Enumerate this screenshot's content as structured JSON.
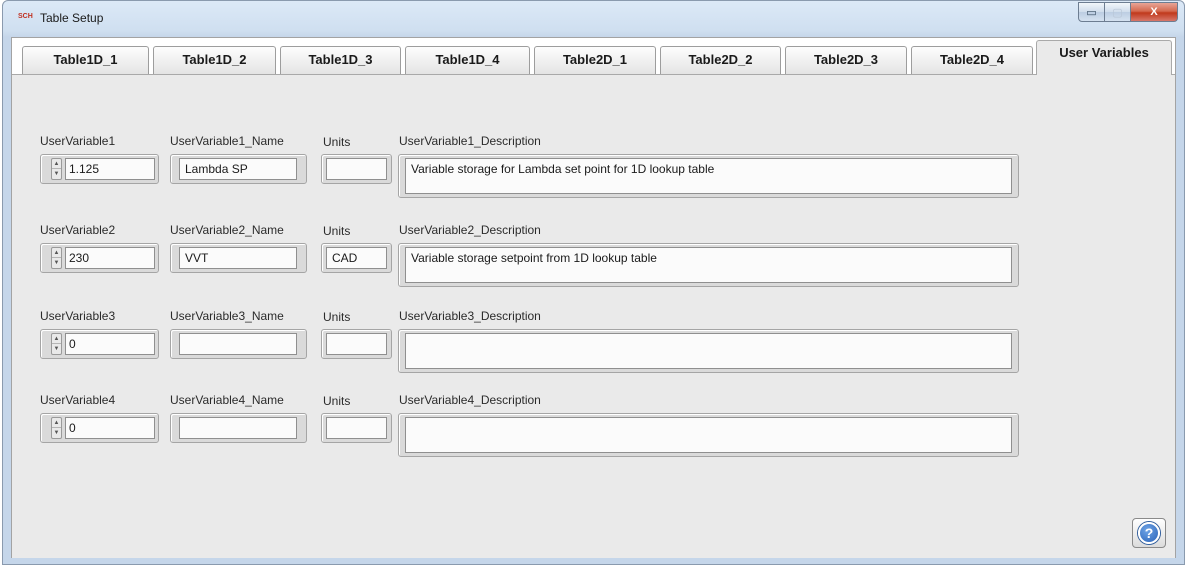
{
  "window": {
    "title": "Table Setup",
    "icon_text": "SCH",
    "controls": {
      "minimize": "▭",
      "maximize": "▢",
      "close": "X"
    }
  },
  "tabs": [
    {
      "label": "Table1D_1",
      "active": false
    },
    {
      "label": "Table1D_2",
      "active": false
    },
    {
      "label": "Table1D_3",
      "active": false
    },
    {
      "label": "Table1D_4",
      "active": false
    },
    {
      "label": "Table2D_1",
      "active": false
    },
    {
      "label": "Table2D_2",
      "active": false
    },
    {
      "label": "Table2D_3",
      "active": false
    },
    {
      "label": "Table2D_4",
      "active": false
    },
    {
      "label": "User Variables",
      "active": true
    }
  ],
  "variables": [
    {
      "value_label": "UserVariable1",
      "value": "1.125",
      "name_label": "UserVariable1_Name",
      "name": "Lambda SP",
      "units_label": "Units",
      "units": "",
      "desc_label": "UserVariable1_Description",
      "description": "Variable storage for Lambda set point for 1D lookup table"
    },
    {
      "value_label": "UserVariable2",
      "value": "230",
      "name_label": "UserVariable2_Name",
      "name": "VVT",
      "units_label": "Units",
      "units": "CAD",
      "desc_label": "UserVariable2_Description",
      "description": "Variable storage setpoint from 1D lookup table"
    },
    {
      "value_label": "UserVariable3",
      "value": "0",
      "name_label": "UserVariable3_Name",
      "name": "",
      "units_label": "Units",
      "units": "",
      "desc_label": "UserVariable3_Description",
      "description": ""
    },
    {
      "value_label": "UserVariable4",
      "value": "0",
      "name_label": "UserVariable4_Name",
      "name": "",
      "units_label": "Units",
      "units": "",
      "desc_label": "UserVariable4_Description",
      "description": ""
    }
  ],
  "help": {
    "glyph": "?"
  },
  "icons": {
    "spin_up": "▲",
    "spin_down": "▼"
  }
}
